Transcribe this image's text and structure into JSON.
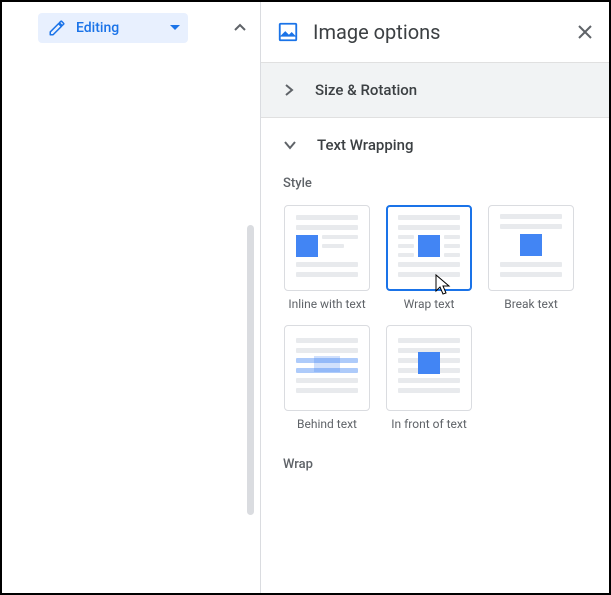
{
  "toolbar": {
    "editing_label": "Editing"
  },
  "panel": {
    "title": "Image options",
    "sections": {
      "size_rotation": "Size & Rotation",
      "text_wrapping": "Text Wrapping"
    },
    "style_label": "Style",
    "wrap_label": "Wrap",
    "tiles": {
      "inline": "Inline with text",
      "wrap": "Wrap text",
      "break": "Break text",
      "behind": "Behind text",
      "front": "In front of text"
    }
  }
}
